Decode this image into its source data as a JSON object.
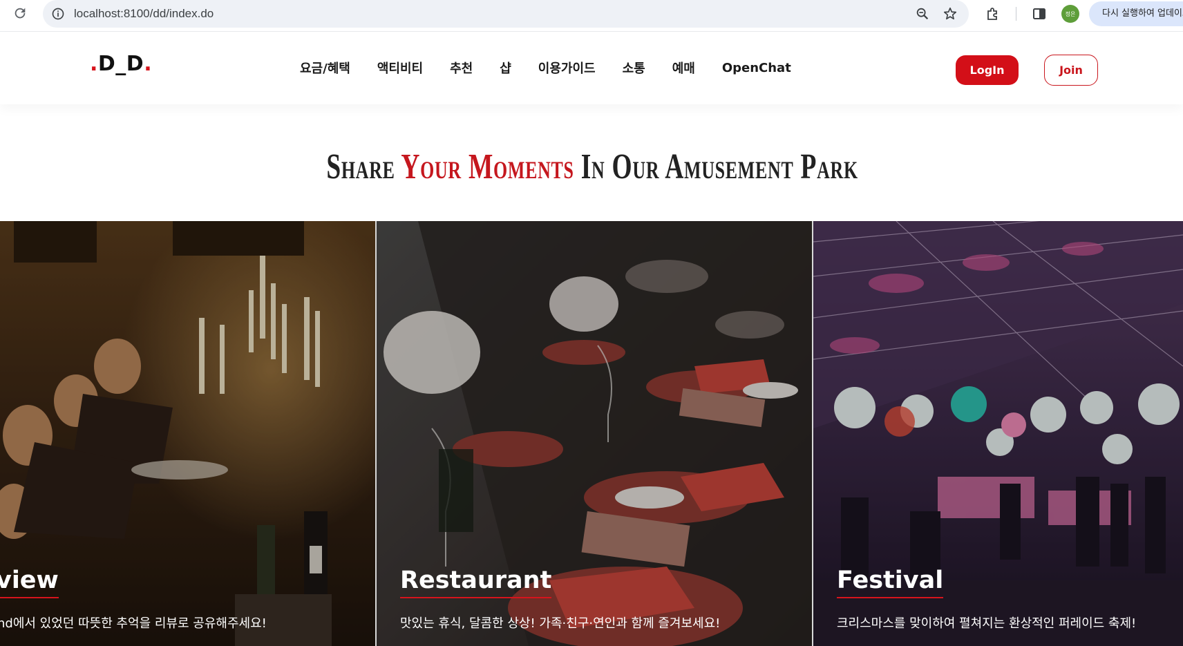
{
  "browser": {
    "url": "localhost:8100/dd/index.do",
    "profile_initials": "정은",
    "relaunch_label": "다시 실행하여 업데이트"
  },
  "site": {
    "logo": {
      "dot_left": ".",
      "text": "D_D",
      "dot_right": "."
    },
    "nav": [
      "요금/혜택",
      "액티비티",
      "추천",
      "샵",
      "이용가이드",
      "소통",
      "예매",
      "OpenChat"
    ],
    "login_label": "LogIn",
    "join_label": "Join"
  },
  "section": {
    "title_part1": "Share ",
    "title_accent": "Your Moments",
    "title_part2": " In Our Amusement Park"
  },
  "cards": [
    {
      "title": "view",
      "desc": "nd에서 있었던 따뜻한 추억을 리뷰로 공유해주세요!"
    },
    {
      "title": "Restaurant",
      "desc": "맛있는 휴식, 달콤한 상상! 가족·친구·연인과 함께 즐겨보세요!"
    },
    {
      "title": "Festival",
      "desc": "크리스마스를 맞이하여 펼쳐지는 환상적인 퍼레이드 축제!"
    }
  ],
  "colors": {
    "brand_red": "#d30f18",
    "nav_text": "#1a1a1a"
  }
}
